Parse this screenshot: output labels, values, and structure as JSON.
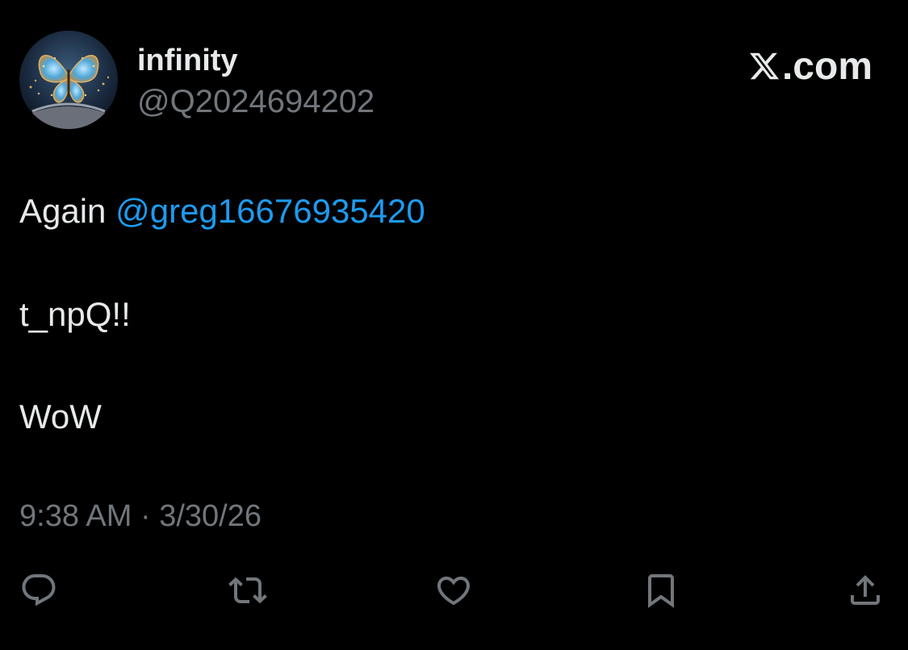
{
  "author": {
    "display_name": "infinity",
    "handle": "@Q2024694202",
    "avatar_icon": "butterfly-avatar"
  },
  "brand": {
    "logo_icon": "x-logo-icon",
    "suffix": ".com"
  },
  "tweet": {
    "line1_prefix": "Again",
    "mention": "@greg16676935420",
    "line2": "t_npQ!!",
    "line3": "WoW",
    "timestamp": "9:38 AM · 3/30/26"
  },
  "actions": [
    {
      "name": "reply",
      "icon": "reply-icon"
    },
    {
      "name": "repost",
      "icon": "repost-icon"
    },
    {
      "name": "like",
      "icon": "heart-icon"
    },
    {
      "name": "bookmark",
      "icon": "bookmark-icon"
    },
    {
      "name": "share",
      "icon": "share-icon"
    }
  ],
  "colors": {
    "background": "#000000",
    "primary_text": "#e7e9ea",
    "secondary_text": "#71767b",
    "link": "#1d9bf0"
  }
}
